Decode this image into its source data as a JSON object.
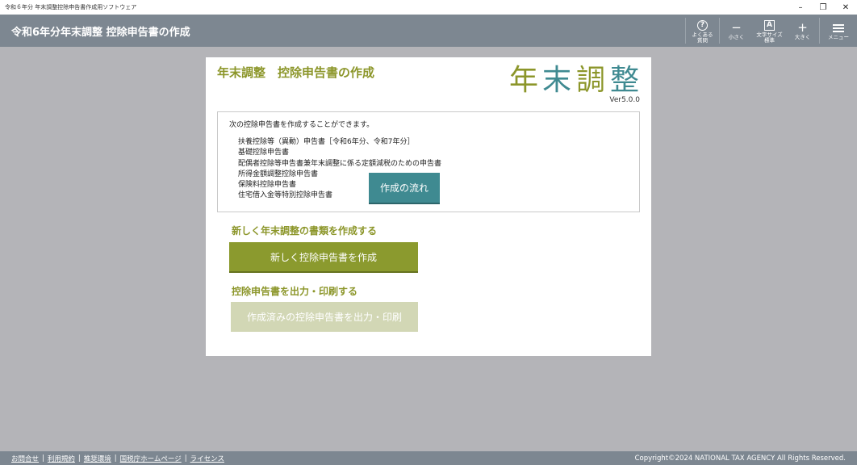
{
  "window": {
    "title": "令和６年分 年末調整控除申告書作成用ソフトウェア",
    "minimize": "–",
    "restore": "❐",
    "close": "✕"
  },
  "header": {
    "title": "令和6年分年末調整 控除申告書の作成",
    "buttons": {
      "faq": {
        "icon": "?",
        "label1": "よくある",
        "label2": "質問"
      },
      "smaller": {
        "icon": "−",
        "label": "小さく"
      },
      "fontsize": {
        "icon": "A",
        "label1": "文字サイズ",
        "label2": "標準"
      },
      "larger": {
        "icon": "+",
        "label": "大きく"
      },
      "menu": {
        "label": "メニュー"
      }
    }
  },
  "panel": {
    "title": "年末調整　控除申告書の作成",
    "logo": {
      "chars": [
        "年",
        "末",
        "調",
        "整"
      ],
      "colors": [
        "#8c962a",
        "#3f8a91",
        "#8c962a",
        "#3f8a91"
      ]
    },
    "version": "Ver5.0.0",
    "info": {
      "lead": "次の控除申告書を作成することができます。",
      "items": [
        "扶養控除等（異動）申告書［令和6年分、令和7年分］",
        "基礎控除申告書",
        "配偶者控除等申告書兼年末調整に係る定額減税のための申告書",
        "所得金額調整控除申告書",
        "保険料控除申告書",
        "住宅借入金等特別控除申告書"
      ],
      "flow_button": "作成の流れ"
    },
    "section_new": {
      "heading": "新しく年末調整の書類を作成する",
      "button": "新しく控除申告書を作成"
    },
    "section_print": {
      "heading": "控除申告書を出力・印刷する",
      "button": "作成済みの控除申告書を出力・印刷"
    }
  },
  "footer": {
    "links": [
      "お問合せ",
      "利用規約",
      "推奨環境",
      "国税庁ホームページ",
      "ライセンス"
    ],
    "separator": "|",
    "copyright": "Copyright©2024 NATIONAL TAX AGENCY All Rights Reserved."
  },
  "colors": {
    "accent": "#8c962a",
    "teal": "#3f8a91",
    "header": "#7d8791",
    "background": "#b4b4b8",
    "disabled": "#d2d7b5"
  }
}
